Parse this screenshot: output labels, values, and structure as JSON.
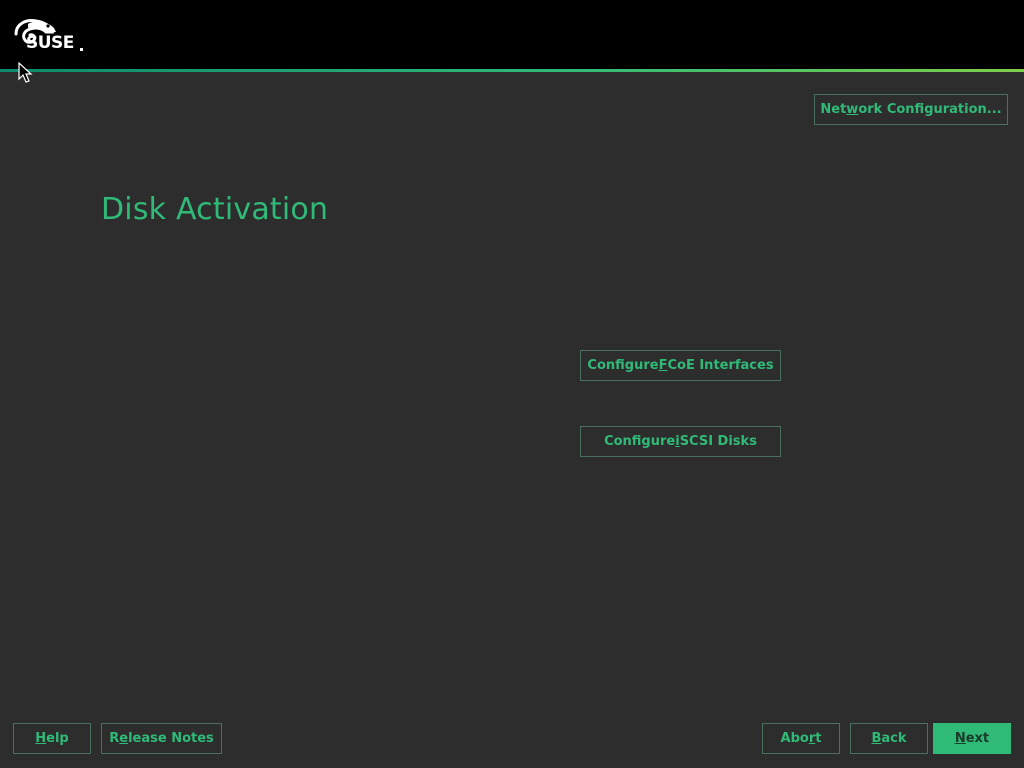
{
  "header": {
    "logo_text": "SUSE",
    "logo_icon": "chameleon-logo-icon"
  },
  "page": {
    "title": "Disk Activation"
  },
  "buttons": {
    "network_config": {
      "pre": "Net",
      "u": "w",
      "post": "ork Configuration..."
    },
    "fcoe": {
      "pre": "Configure ",
      "u": "F",
      "post": "CoE Interfaces"
    },
    "iscsi": {
      "pre": "Configure ",
      "u": "i",
      "post": "SCSI Disks"
    }
  },
  "footer": {
    "help": {
      "pre": "",
      "u": "H",
      "post": "elp"
    },
    "release_notes": {
      "pre": "R",
      "u": "e",
      "post": "lease Notes"
    },
    "abort": {
      "pre": "Abo",
      "u": "r",
      "post": "t"
    },
    "back": {
      "pre": "",
      "u": "B",
      "post": "ack"
    },
    "next": {
      "pre": "",
      "u": "N",
      "post": "ext"
    }
  },
  "colors": {
    "accent": "#30ba78",
    "background": "#2d2d2d",
    "topbar": "#000000"
  }
}
